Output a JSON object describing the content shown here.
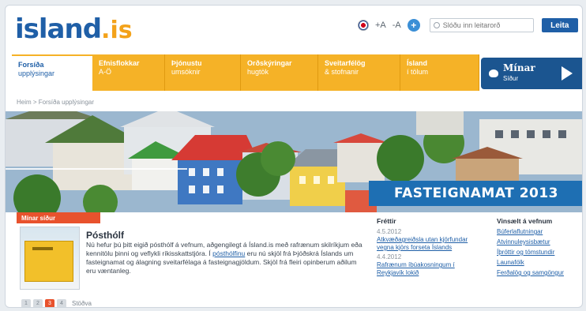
{
  "logo": {
    "word": "island",
    "dot": ".",
    "tld": "is"
  },
  "header": {
    "font_larger": "+A",
    "font_smaller": "-A",
    "search_placeholder": "Slóðu inn leitarorð",
    "search_button": "Leita"
  },
  "nav": {
    "items": [
      {
        "title": "Forsíða",
        "sub": "upplýsingar"
      },
      {
        "title": "Efnisflokkar",
        "sub": "A-Ö"
      },
      {
        "title": "Þjónustu",
        "sub": "umsóknir"
      },
      {
        "title": "Orðskýringar",
        "sub": "hugtök"
      },
      {
        "title": "Sveitarfélög",
        "sub": "& stofnanir"
      },
      {
        "title": "Ísland",
        "sub": "í tölum"
      }
    ],
    "minar_title": "Mínar",
    "minar_sub": "Síður"
  },
  "breadcrumb": "Heim > Forsíða upplýsingar",
  "hero": {
    "banner": "FASTEIGNAMAT 2013"
  },
  "minar_tag": "Mínar síður",
  "post": {
    "title": "Pósthólf",
    "body_1": "Nú hefur þú þitt eigið pósthólf á vefnum, aðgengilegt á Ísland.is með rafrænum skilríkjum eða kennitölu þinni og veflykli ríkisskattstjóra. Í",
    "link": "pósthólfinu",
    "body_2": "eru nú skjöl frá Þjóðskrá Íslands um fasteignamat og álagning sveitarfélaga á fasteignagjöldum. Skjöl frá fleiri opinberum aðilum eru væntanleg."
  },
  "pager": {
    "pages": [
      "1",
      "2",
      "3",
      "4"
    ],
    "current": 2,
    "stop_label": "Stöðva"
  },
  "news": {
    "heading": "Fréttir",
    "items": [
      {
        "date": "4.5.2012",
        "title": "Atkvæðagreiðsla utan kjörfundar vegna kjörs forseta Íslands"
      },
      {
        "date": "4.4.2012",
        "title": "Rafrænum íbúakosningum í Reykjavík lokið"
      }
    ]
  },
  "popular": {
    "heading": "Vinsælt á vefnum",
    "items": [
      "Búferlaflutningar",
      "Atvinnuleysisbætur",
      "Íþróttir og tómstundir",
      "Launafólk",
      "Ferðalög og samgöngur"
    ]
  }
}
